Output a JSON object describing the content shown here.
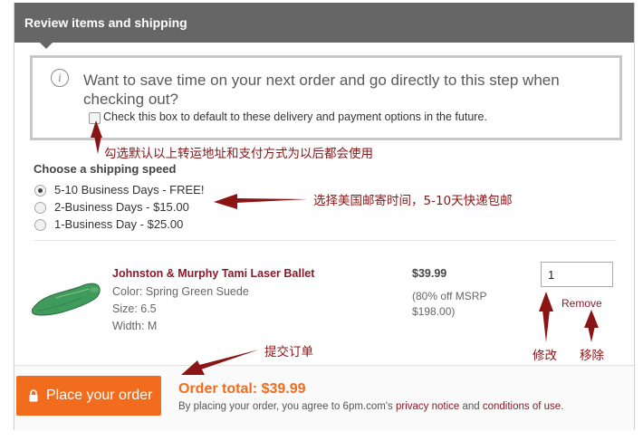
{
  "panel": {
    "title": "Review items and shipping"
  },
  "tip": {
    "message": "Want to save time on your next order and go directly to this step when checking out?",
    "checkbox_label": "Check this box to default to these delivery and payment options in the future.",
    "checkbox_checked": false
  },
  "shipping": {
    "title": "Choose a shipping speed",
    "options": [
      {
        "label": "5-10 Business Days - FREE!",
        "selected": true
      },
      {
        "label": "2-Business Days - $15.00",
        "selected": false
      },
      {
        "label": "1-Business Day - $25.00",
        "selected": false
      }
    ]
  },
  "item": {
    "name": "Johnston & Murphy Tami Laser Ballet",
    "color": "Color: Spring Green Suede",
    "size": "Size: 6.5",
    "width": "Width: M",
    "price": "$39.99",
    "discount_line1": "(80% off MSRP",
    "discount_line2": "$198.00)",
    "quantity": "1",
    "remove_label": "Remove"
  },
  "footer": {
    "button_label": "Place your order",
    "order_total": "Order total: $39.99",
    "legal_prefix": "By placing your order, you agree to 6pm.com's ",
    "privacy_link": "privacy notice",
    "legal_and": " and ",
    "conditions_link": "conditions of use",
    "legal_suffix": "."
  },
  "annotations": {
    "default_note": "勾选默认以上转运地址和支付方式为以后都会使用",
    "shipping_note": "选择美国邮寄时间，5-10天快递包邮",
    "submit_note": "提交订单",
    "modify_note": "修改",
    "remove_note": "移除"
  },
  "colors": {
    "header": "#666666",
    "accent_orange": "#f26c1d",
    "link_maroon": "#8a1a2a",
    "annotation_red": "#8b1414",
    "shoe_green": "#3f9a5c"
  },
  "icons": {
    "info": "info-circle-icon",
    "lock": "lock-icon",
    "product": "green-ballet-flat-shoe"
  }
}
